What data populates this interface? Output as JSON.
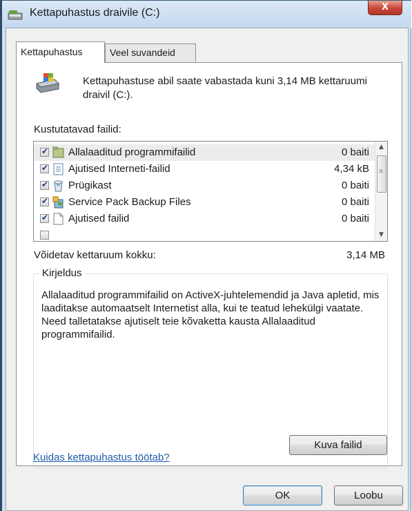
{
  "window": {
    "title": "Kettapuhastus draivile  (C:)",
    "close_glyph": "X"
  },
  "tabs": [
    {
      "label": "Kettapuhastus",
      "active": true
    },
    {
      "label": "Veel suvandeid",
      "active": false
    }
  ],
  "intro": {
    "text": "Kettapuhastuse abil saate vabastada kuni 3,14 MB kettaruumi draivil  (C:).",
    "icon": "disk-cleanup-icon"
  },
  "files_label": "Kustutatavad failid:",
  "files": [
    {
      "name": "Allalaaditud programmifailid",
      "size": "0 baiti",
      "checked": true,
      "selected": true,
      "icon": "folder-icon"
    },
    {
      "name": "Ajutised Interneti-failid",
      "size": "4,34 kB",
      "checked": true,
      "selected": false,
      "icon": "document-icon"
    },
    {
      "name": "Prügikast",
      "size": "0 baiti",
      "checked": true,
      "selected": false,
      "icon": "recycle-bin-icon"
    },
    {
      "name": "Service Pack Backup Files",
      "size": "0 baiti",
      "checked": true,
      "selected": false,
      "icon": "setup-icon"
    },
    {
      "name": "Ajutised failid",
      "size": "0 baiti",
      "checked": true,
      "selected": false,
      "icon": "blank-file-icon"
    }
  ],
  "total": {
    "label": "Võidetav kettaruum kokku:",
    "value": "3,14 MB"
  },
  "description": {
    "title": "Kirjeldus",
    "text": "Allalaaditud programmifailid on ActiveX-juhtelemendid ja Java apletid, mis laaditakse automaatselt Internetist alla, kui te teatud lehekülgi vaatate. Need talletatakse ajutiselt teie kõvaketta kausta Allalaaditud programmifailid.",
    "view_files_button": "Kuva failid"
  },
  "help_link": "Kuidas kettapuhastus töötab?",
  "buttons": {
    "ok": "OK",
    "cancel": "Loobu"
  },
  "colors": {
    "window_frame": "#cfe0f1",
    "close_button": "#c7463a",
    "link": "#1d5cab"
  }
}
